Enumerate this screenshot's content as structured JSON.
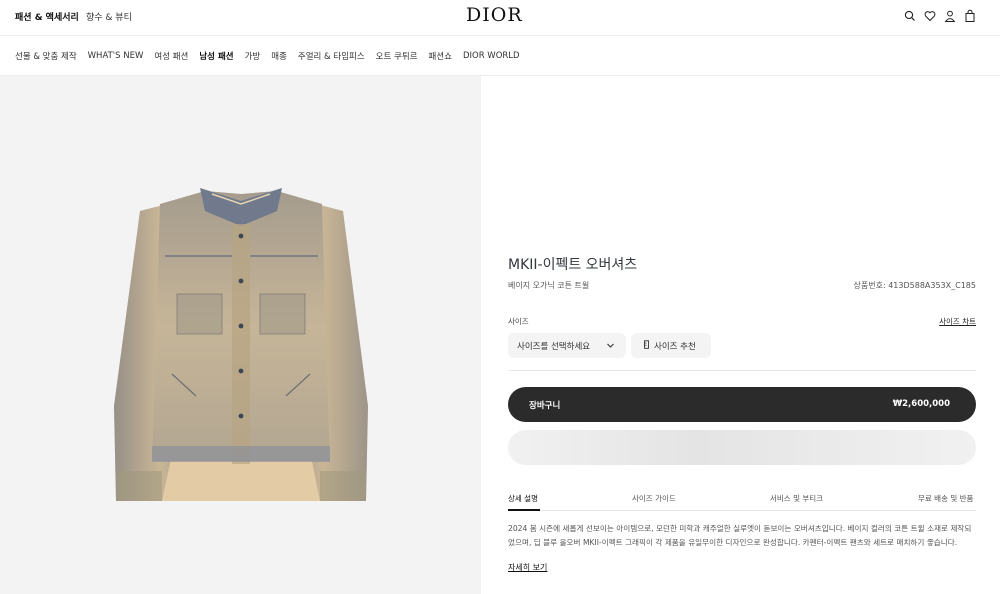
{
  "header": {
    "category_primary": "패션 & 액세서리",
    "category_secondary": "향수 & 뷰티",
    "logo": "DIOR",
    "icons": [
      "search-icon",
      "heart-icon",
      "user-icon",
      "bag-icon"
    ]
  },
  "nav": {
    "items": [
      "선물 & 맞춤 제작",
      "WHAT'S NEW",
      "여성 패션",
      "남성 패션",
      "가방",
      "매종",
      "주얼리 & 타임피스",
      "오트 쿠튀르",
      "패션쇼",
      "DIOR WORLD"
    ],
    "active_index": 3
  },
  "product": {
    "title": "MKII-이펙트 오버셔츠",
    "subtitle": "베이지 오가닉 코튼 트윌",
    "reference": "상품번호: 413D588A353X_C185",
    "size_label": "사이즈",
    "size_guide_link": "사이즈 차트",
    "size_select": "사이즈를 선택하세요",
    "size_recommend": "사이즈 추천",
    "cart_label": "장바구니",
    "price": "₩2,600,000"
  },
  "tabs": [
    "상세 설명",
    "사이즈 가이드",
    "서비스 및 부티크",
    "무료 배송 및 반품"
  ],
  "description": "2024 봄 시즌에 새롭게 선보이는 아이템으로, 모던한 미학과 캐주얼한 실루엣이 돋보이는 오버셔츠입니다. 베이지 컬러의 코튼 트윌 소재로 제작되었으며, 딥 블루 올오버 MKII-이펙트 그래픽이 각 제품을 유일무이한 디자인으로 완성합니다. 카펜터-이펙트 팬츠와 세트로 매치하기 좋습니다.",
  "more_link": "자세히 보기",
  "colors": {
    "jacket_base": "#e2cda4",
    "jacket_shadow": "#5d6577",
    "cart_bg": "#2b2b2b",
    "gallery_bg": "#f3f3f3"
  }
}
